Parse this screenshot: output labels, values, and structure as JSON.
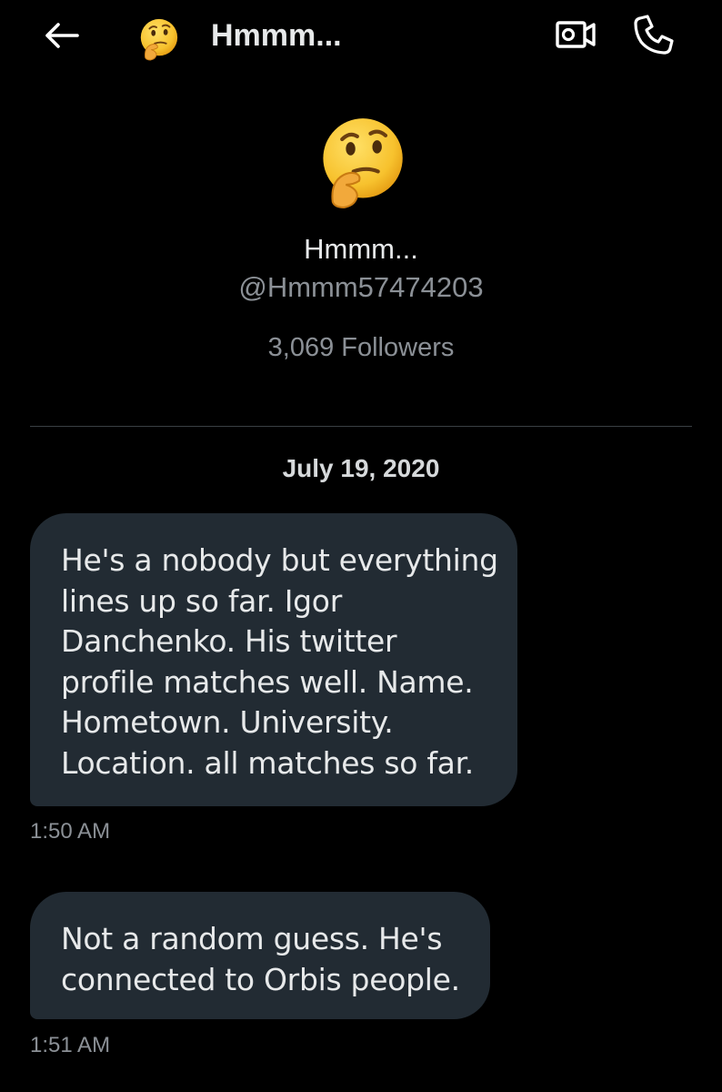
{
  "header": {
    "title": "Hmmm...",
    "back_icon": "arrow-left-icon",
    "avatar_icon": "thinking-face-emoji",
    "video_icon": "video-camera-icon",
    "call_icon": "phone-icon"
  },
  "profile": {
    "avatar_icon": "thinking-face-emoji",
    "name": "Hmmm...",
    "handle": "@Hmmm57474203",
    "followers": "3,069 Followers"
  },
  "conversation": {
    "date": "July 19, 2020",
    "messages": [
      {
        "lines": [
          "He's a nobody but everything",
          "lines up so far.  Igor",
          "Danchenko.   His twitter",
          "profile matches well.  Name.",
          "Hometown.  University.",
          "Location.  all matches so far."
        ],
        "time": "1:50 AM"
      },
      {
        "lines": [
          "Not a random guess.  He's",
          "connected to Orbis people."
        ],
        "time": "1:51 AM"
      }
    ]
  },
  "colors": {
    "background": "#000000",
    "bubble": "#222b33",
    "text_primary": "#e7e9ea",
    "text_secondary": "#8b9096",
    "emoji_yellow": "#f7c22e"
  }
}
